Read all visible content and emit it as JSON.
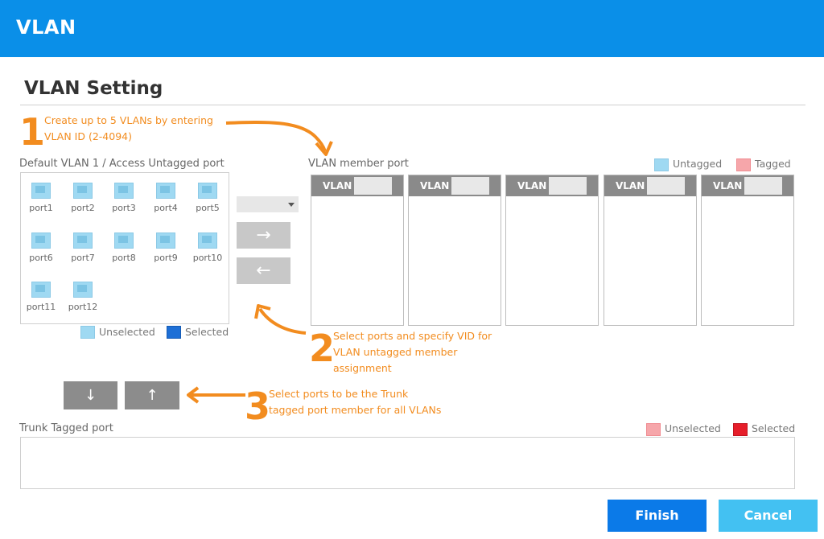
{
  "header": {
    "title": "VLAN"
  },
  "page": {
    "title": "VLAN Setting"
  },
  "steps": [
    {
      "num": "1",
      "line1": "Create up to 5 VLANs by entering",
      "line2": "VLAN ID (2-4094)"
    },
    {
      "num": "2",
      "line1": "Select ports and specify VID for",
      "line2": "VLAN untagged member",
      "line3": "assignment"
    },
    {
      "num": "3",
      "line1": "Select ports to be the Trunk",
      "line2": "tagged port member for all VLANs"
    }
  ],
  "access": {
    "label": "Default VLAN 1 / Access Untagged port",
    "ports": [
      "port1",
      "port2",
      "port3",
      "port4",
      "port5",
      "port6",
      "port7",
      "port8",
      "port9",
      "port10",
      "port11",
      "port12"
    ],
    "legend_unselected": "Unselected",
    "legend_selected": "Selected"
  },
  "member": {
    "label": "VLAN member port",
    "legend_untagged": "Untagged",
    "legend_tagged": "Tagged",
    "columns": [
      "VLAN",
      "VLAN",
      "VLAN",
      "VLAN",
      "VLAN"
    ]
  },
  "buttons": {
    "move_right": "→",
    "move_left": "←",
    "move_down": "↓",
    "move_up": "↑",
    "finish": "Finish",
    "cancel": "Cancel"
  },
  "trunk": {
    "label": "Trunk Tagged port",
    "legend_unselected": "Unselected",
    "legend_selected": "Selected"
  },
  "colors": {
    "header": "#0a8fe8",
    "accent_orange": "#f28c1f",
    "finish": "#0b7ae8",
    "cancel": "#43c1f2"
  }
}
